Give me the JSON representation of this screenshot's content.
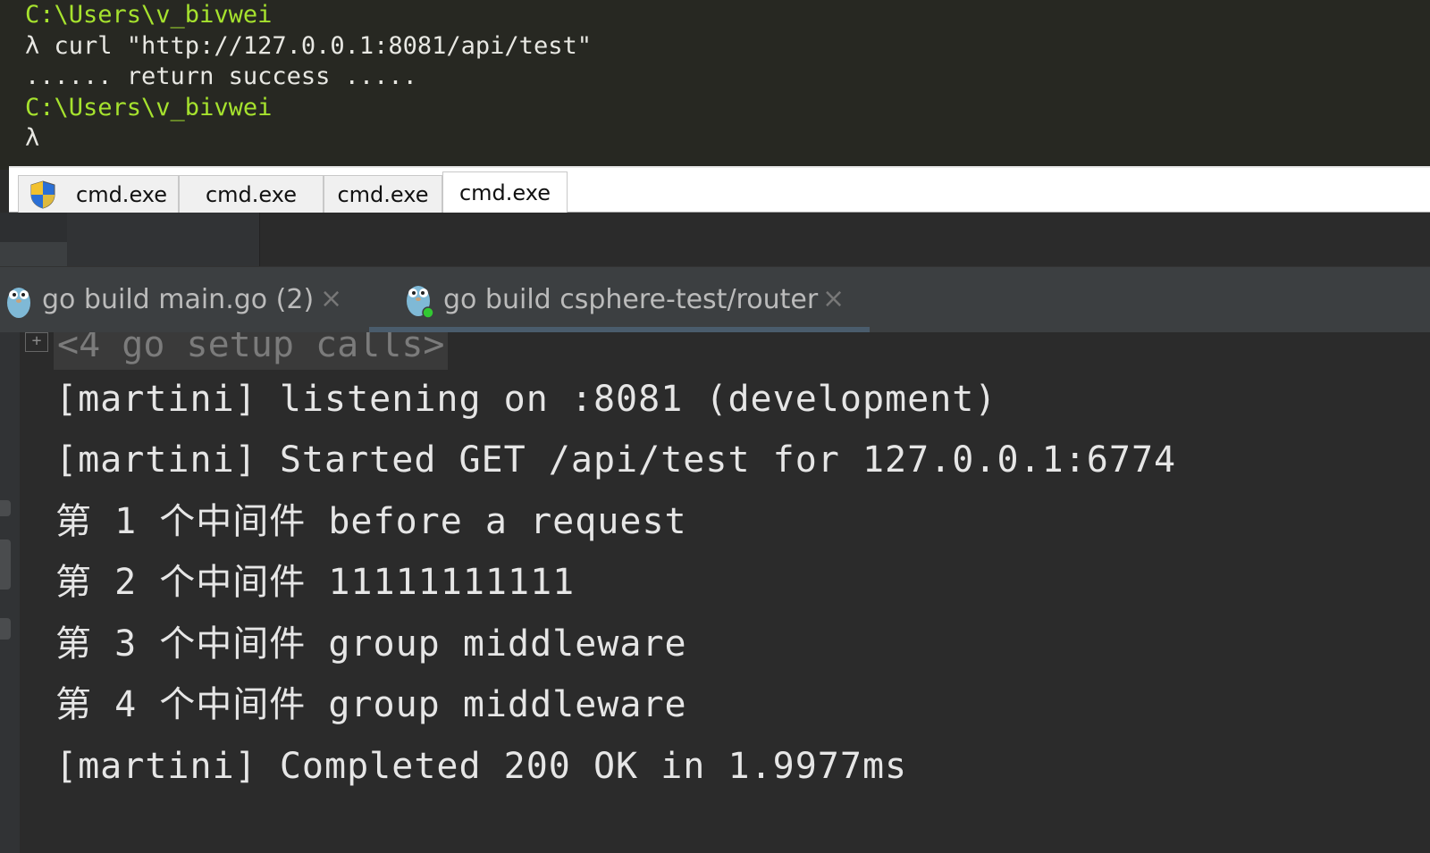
{
  "console": {
    "lines": [
      {
        "text": "C:\\Users\\v_bivwei",
        "kind": "path"
      },
      {
        "text": "λ curl \"http://127.0.0.1:8081/api/test\"",
        "kind": "cmd"
      },
      {
        "text": "...... return success .....",
        "kind": "output"
      },
      {
        "text": "C:\\Users\\v_bivwei",
        "kind": "path"
      },
      {
        "text": "λ",
        "kind": "cmd"
      }
    ],
    "tabs": [
      {
        "label": "cmd.exe",
        "icon": "shield-icon",
        "active": false
      },
      {
        "label": "cmd.exe [*]",
        "active": false
      },
      {
        "label": "cmd.exe",
        "active": false
      },
      {
        "label": "cmd.exe",
        "active": true
      }
    ]
  },
  "run_panel": {
    "tabs": [
      {
        "label": "go build main.go (2)",
        "icon": "gopher-icon",
        "close": "×",
        "active": false
      },
      {
        "label": "go build csphere-test/router",
        "icon": "gopher-running-icon",
        "close": "×",
        "active": true
      }
    ],
    "fold_symbol": "+",
    "collapsed_calls": "<4 go setup calls>",
    "output_lines": [
      "[martini] listening on :8081 (development)",
      "[martini] Started GET /api/test for 127.0.0.1:6774",
      "第 1 个中间件 before a request",
      "第 2 个中间件 11111111111",
      "第 3 个中间件 group middleware",
      "第 4 个中间件 group middleware",
      "[martini] Completed 200 OK in 1.9977ms"
    ]
  },
  "colors": {
    "console_bg": "#272822",
    "prompt_path": "#a6e22e",
    "ide_bg": "#2b2b2b",
    "ide_text": "#e6e6e6"
  }
}
